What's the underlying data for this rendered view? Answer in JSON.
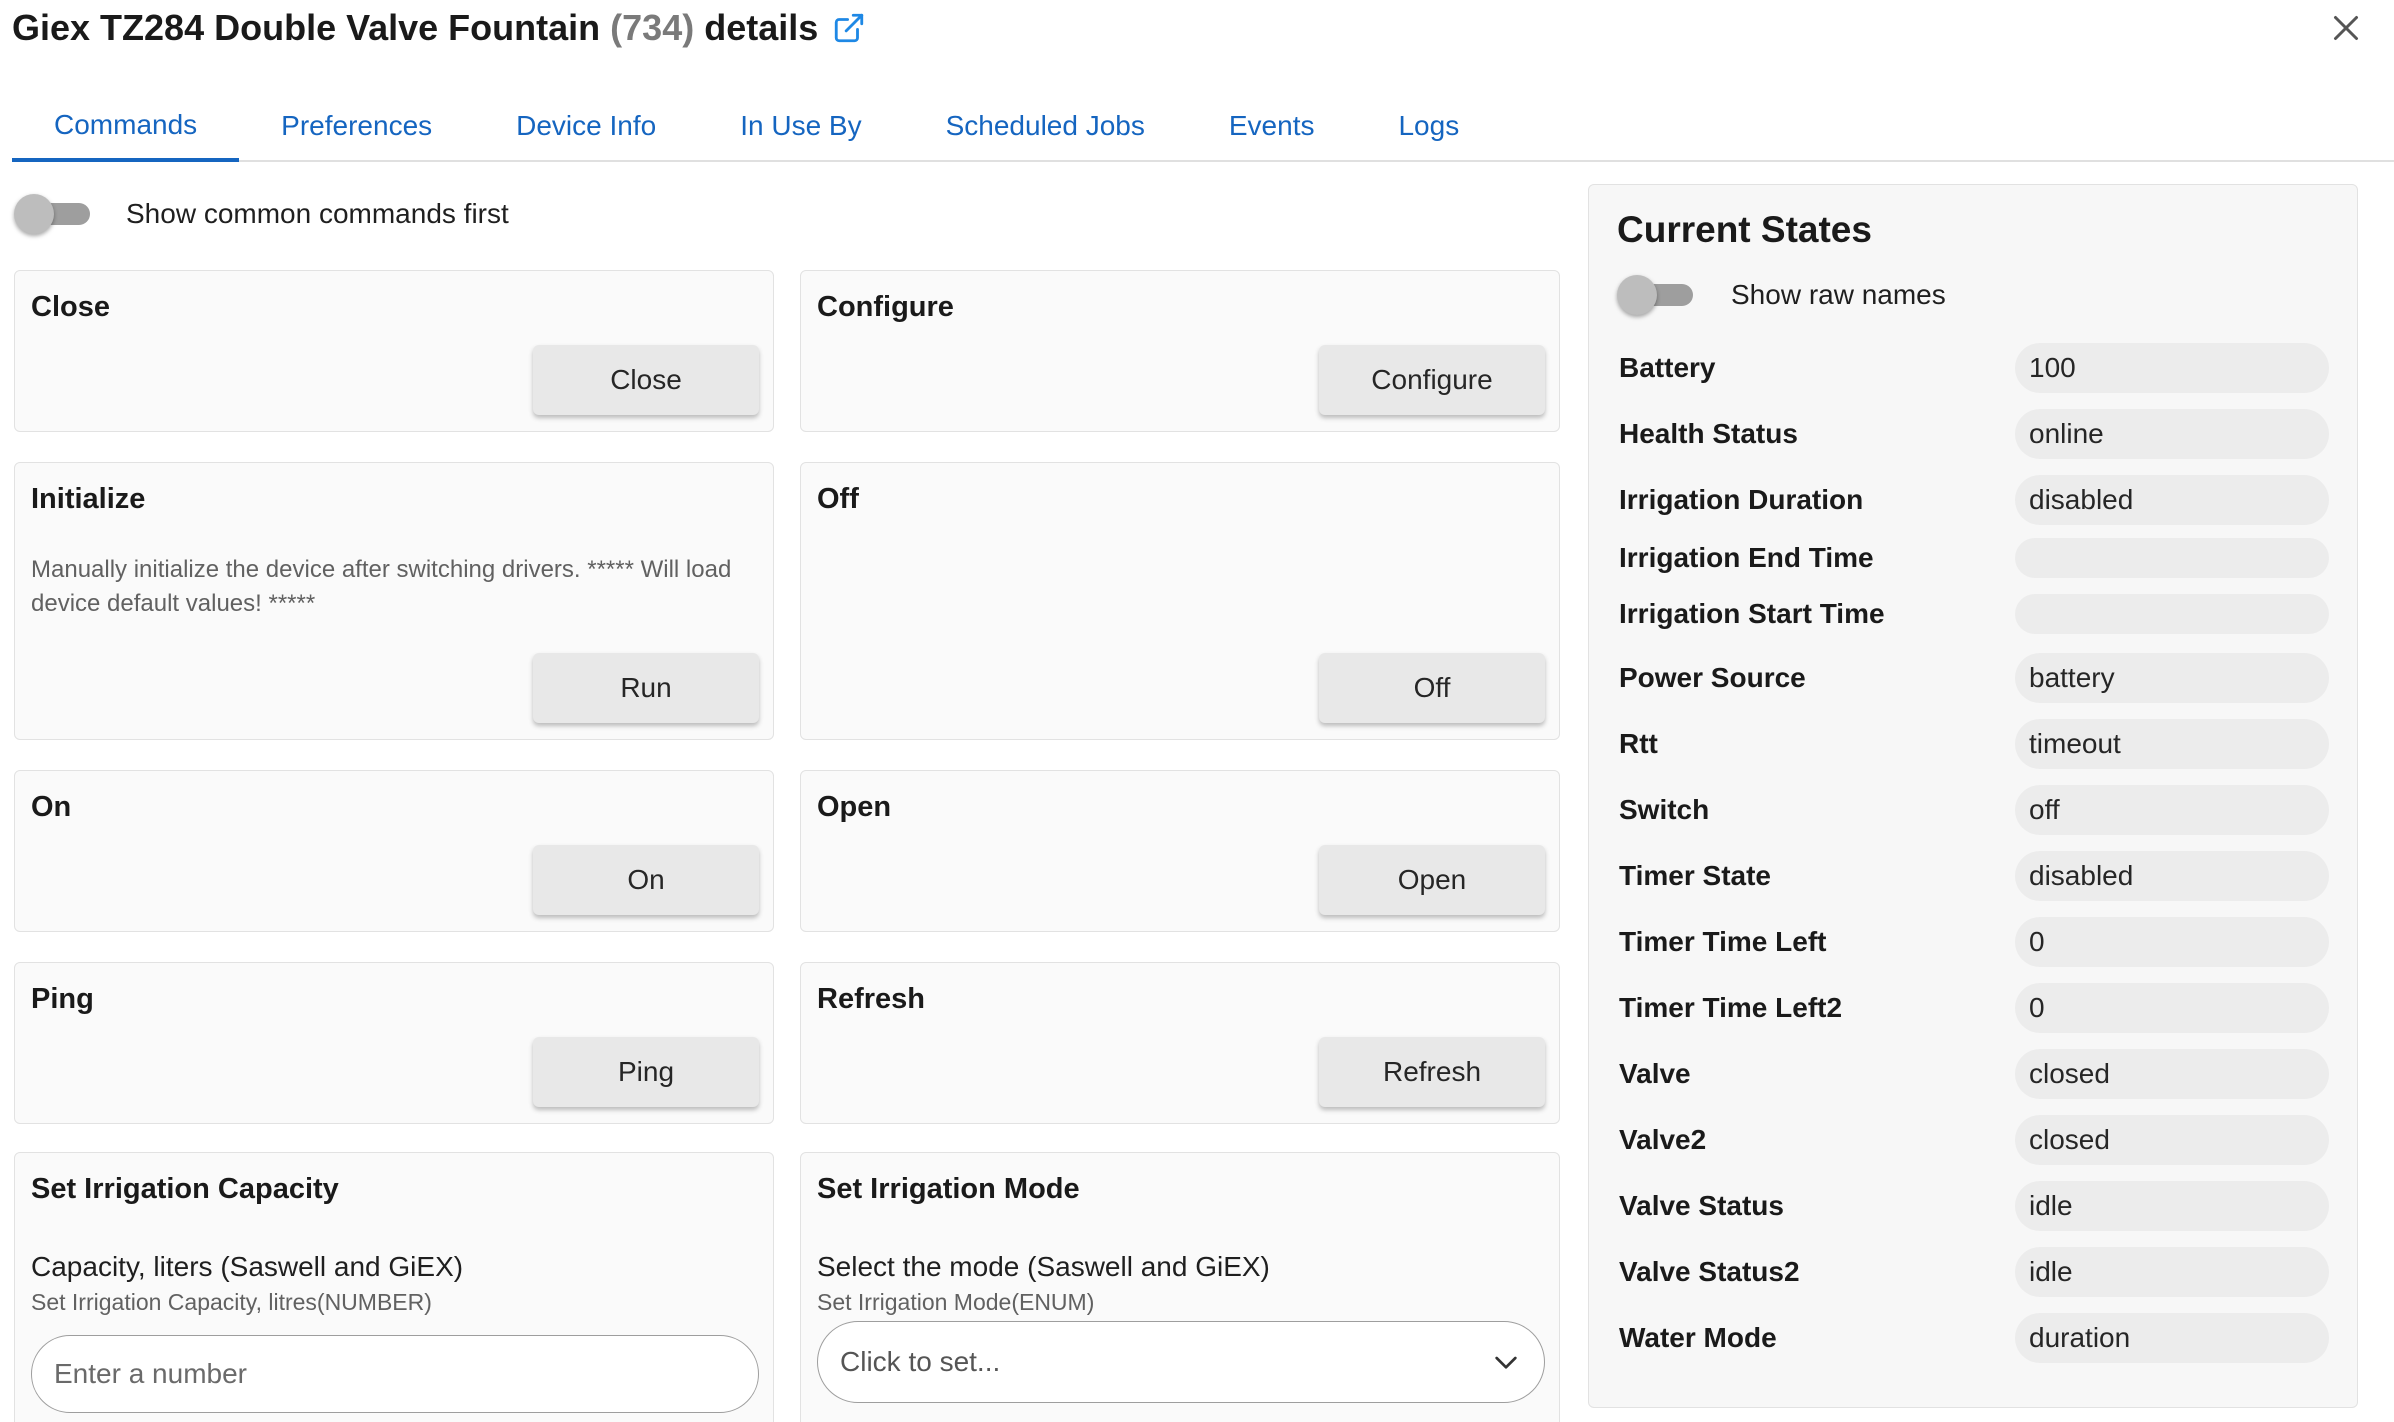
{
  "header": {
    "title_prefix": "Giex TZ284 Double Valve Fountain ",
    "title_id": "(734)",
    "title_suffix": " details"
  },
  "tabs": [
    {
      "label": "Commands",
      "active": true
    },
    {
      "label": "Preferences"
    },
    {
      "label": "Device Info"
    },
    {
      "label": "In Use By"
    },
    {
      "label": "Scheduled Jobs"
    },
    {
      "label": "Events"
    },
    {
      "label": "Logs"
    }
  ],
  "commands_toggle": {
    "label": "Show common commands first",
    "on": false
  },
  "commands": [
    {
      "title": "Close",
      "button": "Close"
    },
    {
      "title": "Configure",
      "button": "Configure"
    },
    {
      "title": "Initialize",
      "description": "Manually initialize the device after switching drivers. ***** Will load device default values! *****",
      "button": "Run"
    },
    {
      "title": "Off",
      "button": "Off"
    },
    {
      "title": "On",
      "button": "On"
    },
    {
      "title": "Open",
      "button": "Open"
    },
    {
      "title": "Ping",
      "button": "Ping"
    },
    {
      "title": "Refresh",
      "button": "Refresh"
    },
    {
      "title": "Set Irrigation Capacity",
      "param_label": "Capacity, liters (Saswell and GiEX)",
      "param_sub": "Set Irrigation Capacity, litres(NUMBER)",
      "input_placeholder": "Enter a number"
    },
    {
      "title": "Set Irrigation Mode",
      "param_label": "Select the mode (Saswell and GiEX)",
      "param_sub": "Set Irrigation Mode(ENUM)",
      "select_value": "Click to set..."
    }
  ],
  "states": {
    "title": "Current States",
    "toggle_label": "Show raw names",
    "toggle_on": false,
    "rows": [
      {
        "name": "Battery",
        "value": "100"
      },
      {
        "name": "Health Status",
        "value": "online"
      },
      {
        "name": "Irrigation Duration",
        "value": "disabled"
      },
      {
        "name": "Irrigation End Time",
        "value": ""
      },
      {
        "name": "Irrigation Start Time",
        "value": ""
      },
      {
        "name": "Power Source",
        "value": "battery"
      },
      {
        "name": "Rtt",
        "value": "timeout"
      },
      {
        "name": "Switch",
        "value": "off"
      },
      {
        "name": "Timer State",
        "value": "disabled"
      },
      {
        "name": "Timer Time Left",
        "value": "0"
      },
      {
        "name": "Timer Time Left2",
        "value": "0"
      },
      {
        "name": "Valve",
        "value": "closed"
      },
      {
        "name": "Valve2",
        "value": "closed"
      },
      {
        "name": "Valve Status",
        "value": "idle"
      },
      {
        "name": "Valve Status2",
        "value": "idle"
      },
      {
        "name": "Water Mode",
        "value": "duration"
      }
    ]
  },
  "colors": {
    "accent": "#1565c0",
    "card_bg": "#fafafa",
    "state_value_bg": "#ececec"
  },
  "icons": {
    "open_external": "external-link-icon",
    "close": "close-icon",
    "dropdown": "chevron-down-icon"
  }
}
